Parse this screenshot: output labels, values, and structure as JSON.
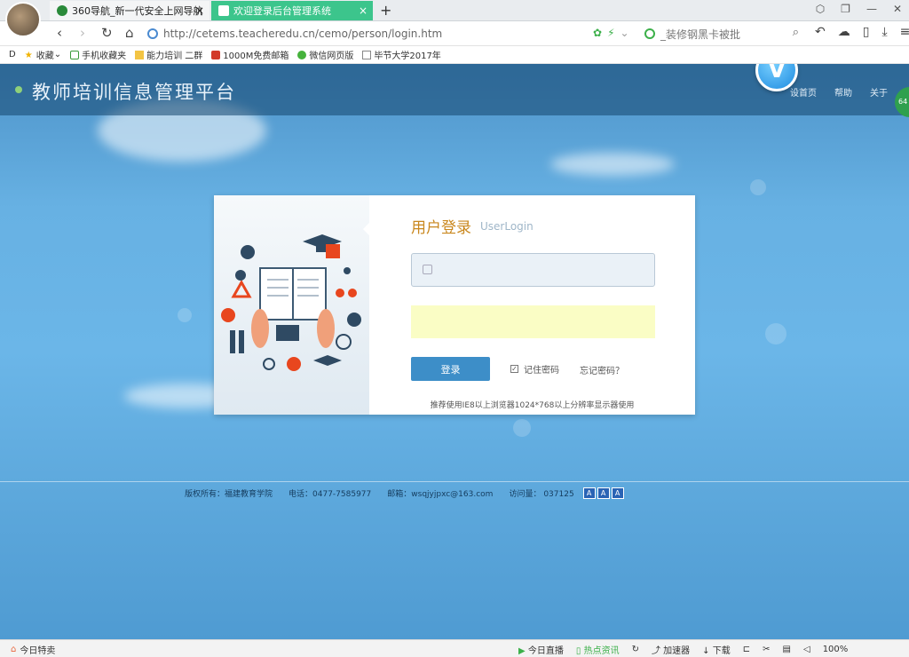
{
  "tabs": [
    {
      "label": "360导航_新一代安全上网导航"
    },
    {
      "label": "欢迎登录后台管理系统"
    }
  ],
  "new_tab_label": "+",
  "address": {
    "url": "http://cetems.teacheredu.cn/cemo/person/login.htm"
  },
  "search": {
    "placeholder": "_装修钢黑卡被批"
  },
  "bookmarks": [
    {
      "label": "收藏",
      "icon": "star-icon"
    },
    {
      "label": "手机收藏夹",
      "icon": "phone-icon"
    },
    {
      "label": "能力培训 二群",
      "icon": "folder-icon"
    },
    {
      "label": "1000M免费邮箱",
      "icon": "mail-icon"
    },
    {
      "label": "微信网页版",
      "icon": "wechat-icon"
    },
    {
      "label": "毕节大学2017年",
      "icon": "page-icon"
    }
  ],
  "site": {
    "title": "教师培训信息管理平台",
    "links": [
      "设首页",
      "帮助",
      "关于"
    ],
    "logo_letter": "V",
    "side_badge": "64"
  },
  "login": {
    "title": "用户登录",
    "subtitle": "UserLogin",
    "button_label": "登录",
    "remember_label": "记住密码",
    "forgot_label": "忘记密码？",
    "tip": "推荐使用IE8以上浏览器1024*768以上分辨率显示器使用"
  },
  "footer": {
    "copyright": "版权所有：福建教育学院",
    "phone": "电话：0477-7585977",
    "email": "邮箱：wsqjyjpxc@163.com",
    "visits": "访问量：  037125",
    "font_buttons": [
      "A",
      "A",
      "A"
    ]
  },
  "statusbar": {
    "left": "今日特卖",
    "items": [
      "今日直播",
      "热点资讯",
      "加速器",
      "下载",
      "100%"
    ]
  },
  "colors": {
    "tab_active": "#3cc58c",
    "accent_blue": "#3d8ec8",
    "title_gold": "#c9871d"
  }
}
